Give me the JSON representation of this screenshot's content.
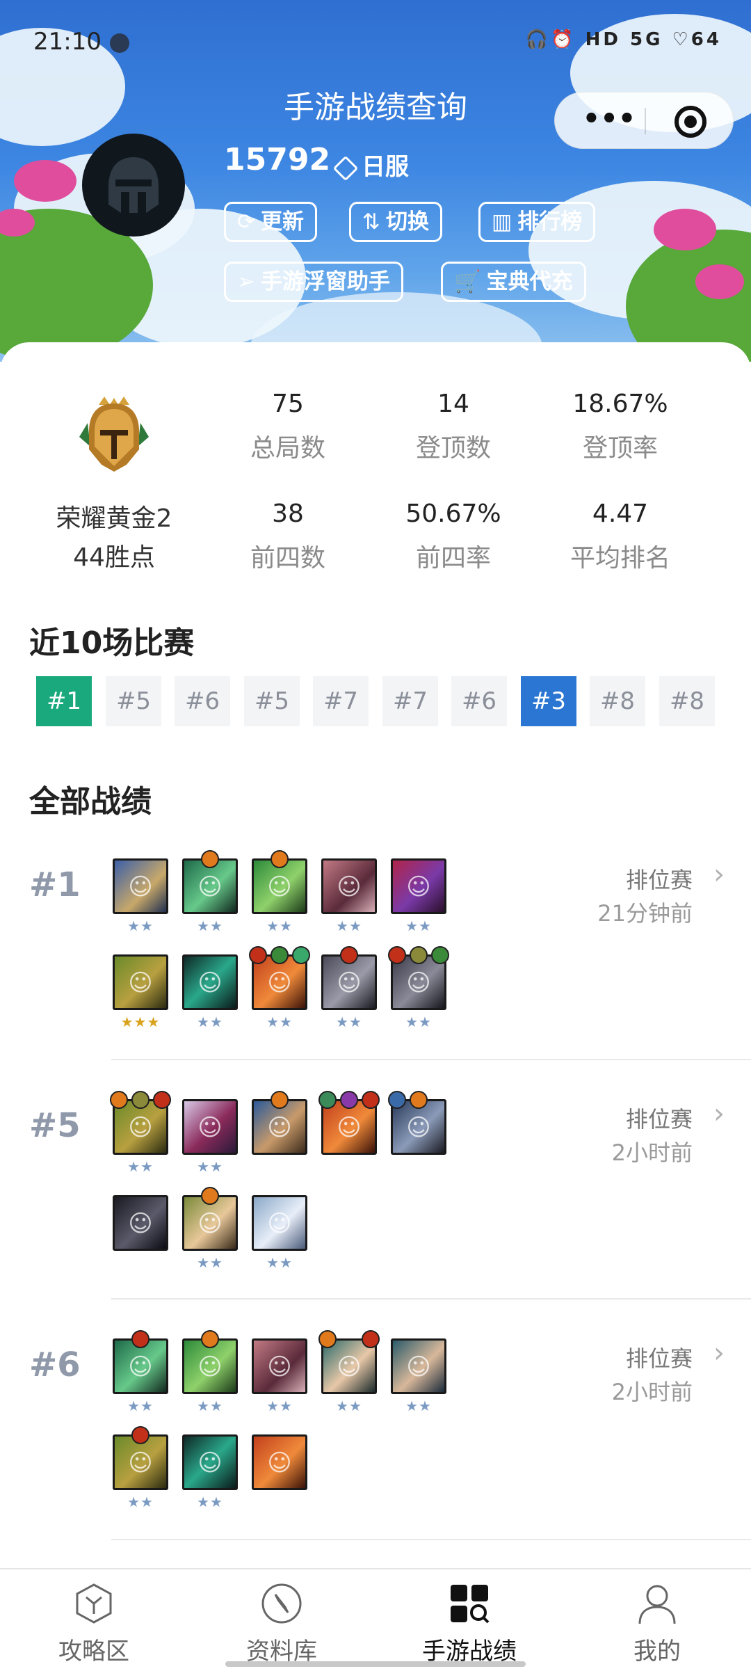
{
  "status_bar": {
    "time": "21:10",
    "icons": "🎧⏰ HD 5G ♡64"
  },
  "header": {
    "title": "手游战绩查询",
    "uid": "15792",
    "server": "日服",
    "buttons": [
      {
        "icon": "refresh-icon",
        "label": "更新"
      },
      {
        "icon": "switch-icon",
        "label": "切换"
      },
      {
        "icon": "leaderboard-icon",
        "label": "排行榜"
      },
      {
        "icon": "send-icon",
        "label": "手游浮窗助手"
      },
      {
        "icon": "cart-icon",
        "label": "宝典代充"
      }
    ],
    "colors": {
      "sky": "#3d86e2",
      "button_border": "#ffffff"
    }
  },
  "profile": {
    "rank_name": "荣耀黄金2",
    "rank_points": "44胜点",
    "stats": [
      {
        "value": "75",
        "label": "总局数"
      },
      {
        "value": "14",
        "label": "登顶数"
      },
      {
        "value": "18.67%",
        "label": "登顶率"
      },
      {
        "value": "38",
        "label": "前四数"
      },
      {
        "value": "50.67%",
        "label": "前四率"
      },
      {
        "value": "4.47",
        "label": "平均排名"
      }
    ]
  },
  "recent": {
    "title": "近10场比赛",
    "placements": [
      "#1",
      "#5",
      "#6",
      "#5",
      "#7",
      "#7",
      "#6",
      "#3",
      "#8",
      "#8"
    ],
    "colors": {
      "first": "#1aa97c",
      "top4": "#2a76d2",
      "other": "#f3f4f6"
    }
  },
  "history": {
    "title": "全部战绩",
    "matches": [
      {
        "place": "#1",
        "mode": "排位赛",
        "ago": "21分钟前",
        "units_shown": 10
      },
      {
        "place": "#5",
        "mode": "排位赛",
        "ago": "2小时前",
        "units_shown": 8
      },
      {
        "place": "#6",
        "mode": "排位赛",
        "ago": "2小时前",
        "units_shown": 8
      }
    ]
  },
  "tabbar": {
    "tabs": [
      {
        "icon": "hexagon-icon",
        "label": "攻略区"
      },
      {
        "icon": "compass-icon",
        "label": "资料库"
      },
      {
        "icon": "grid-search-icon",
        "label": "手游战绩"
      },
      {
        "icon": "person-icon",
        "label": "我的"
      }
    ],
    "active": "手游战绩"
  }
}
